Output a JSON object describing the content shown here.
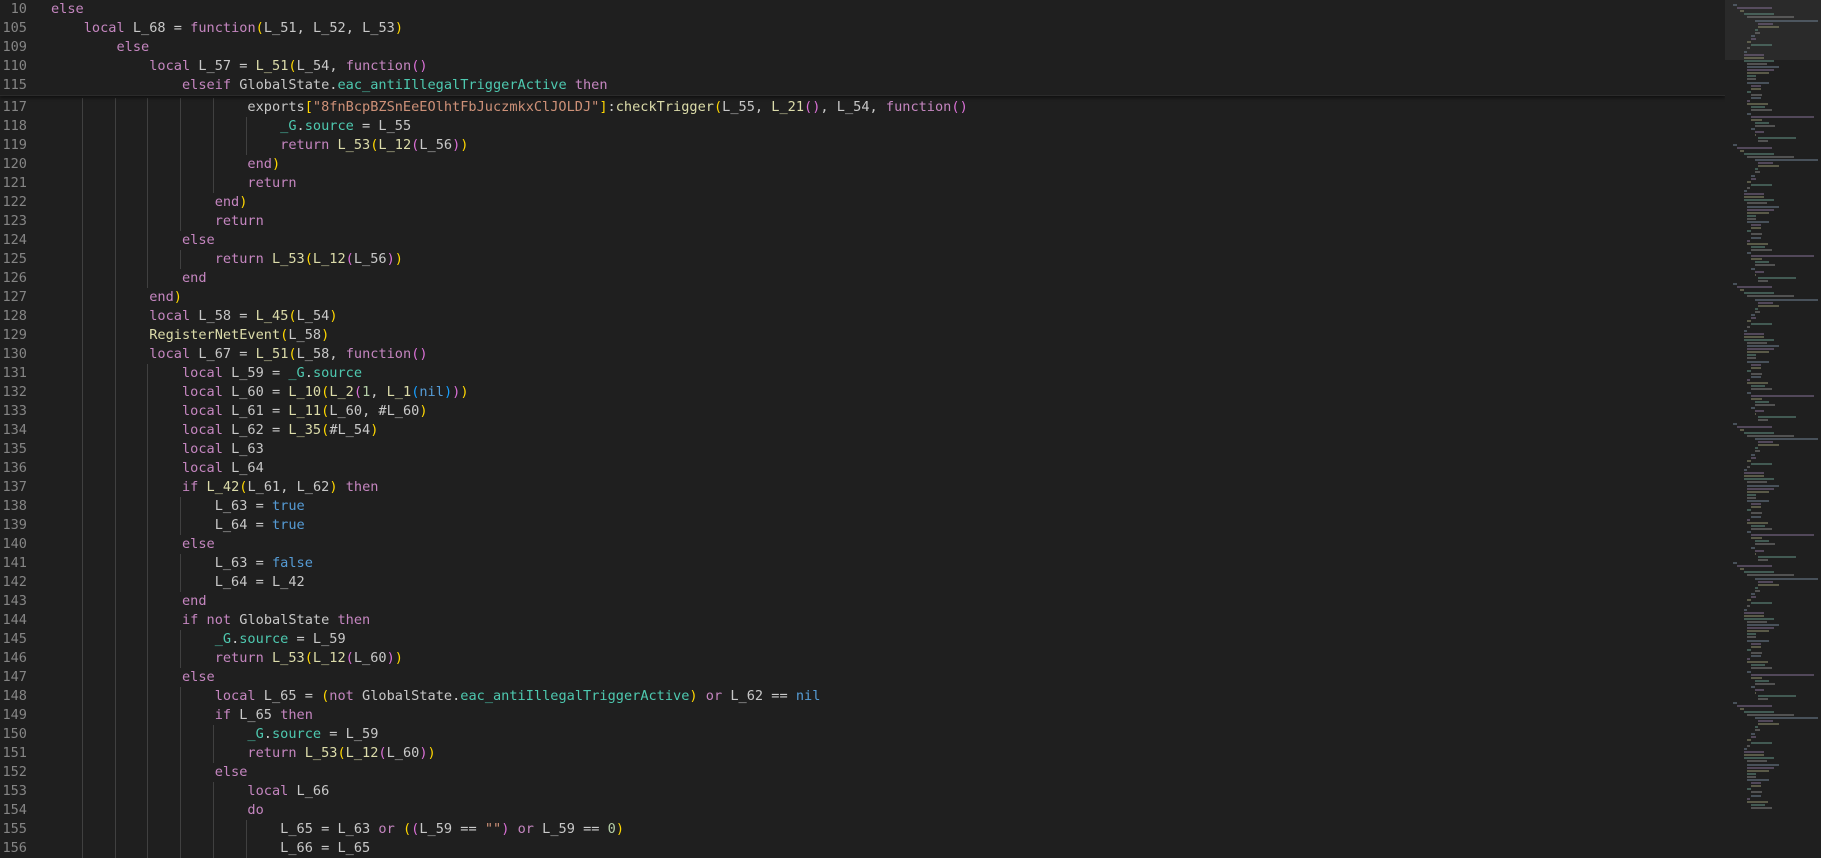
{
  "editor": {
    "sticky_lines": [
      {
        "num": "10",
        "text": "else"
      },
      {
        "num": "105",
        "text": "    local L_68 = function(L_51, L_52, L_53)"
      },
      {
        "num": "109",
        "text": "        else"
      },
      {
        "num": "110",
        "text": "            local L_57 = L_51(L_54, function()"
      },
      {
        "num": "115",
        "text": "                elseif GlobalState.eac_antiIllegalTriggerActive then"
      }
    ],
    "lines": [
      {
        "num": "117",
        "text": "                        exports[\"8fnBcpBZSnEeEOlhtFbJuczmkxClJOLDJ\"]:checkTrigger(L_55, L_21(), L_54, function()"
      },
      {
        "num": "118",
        "text": "                            _G.source = L_55"
      },
      {
        "num": "119",
        "text": "                            return L_53(L_12(L_56))"
      },
      {
        "num": "120",
        "text": "                        end)"
      },
      {
        "num": "121",
        "text": "                        return"
      },
      {
        "num": "122",
        "text": "                    end)"
      },
      {
        "num": "123",
        "text": "                    return"
      },
      {
        "num": "124",
        "text": "                else"
      },
      {
        "num": "125",
        "text": "                    return L_53(L_12(L_56))"
      },
      {
        "num": "126",
        "text": "                end"
      },
      {
        "num": "127",
        "text": "            end)"
      },
      {
        "num": "128",
        "text": "            local L_58 = L_45(L_54)"
      },
      {
        "num": "129",
        "text": "            RegisterNetEvent(L_58)"
      },
      {
        "num": "130",
        "text": "            local L_67 = L_51(L_58, function()"
      },
      {
        "num": "131",
        "text": "                local L_59 = _G.source"
      },
      {
        "num": "132",
        "text": "                local L_60 = L_10(L_2(1, L_1(nil)))"
      },
      {
        "num": "133",
        "text": "                local L_61 = L_11(L_60, #L_60)"
      },
      {
        "num": "134",
        "text": "                local L_62 = L_35(#L_54)"
      },
      {
        "num": "135",
        "text": "                local L_63"
      },
      {
        "num": "136",
        "text": "                local L_64"
      },
      {
        "num": "137",
        "text": "                if L_42(L_61, L_62) then"
      },
      {
        "num": "138",
        "text": "                    L_63 = true"
      },
      {
        "num": "139",
        "text": "                    L_64 = true"
      },
      {
        "num": "140",
        "text": "                else"
      },
      {
        "num": "141",
        "text": "                    L_63 = false"
      },
      {
        "num": "142",
        "text": "                    L_64 = L_42"
      },
      {
        "num": "143",
        "text": "                end"
      },
      {
        "num": "144",
        "text": "                if not GlobalState then"
      },
      {
        "num": "145",
        "text": "                    _G.source = L_59"
      },
      {
        "num": "146",
        "text": "                    return L_53(L_12(L_60))"
      },
      {
        "num": "147",
        "text": "                else"
      },
      {
        "num": "148",
        "text": "                    local L_65 = (not GlobalState.eac_antiIllegalTriggerActive) or L_62 == nil"
      },
      {
        "num": "149",
        "text": "                    if L_65 then"
      },
      {
        "num": "150",
        "text": "                        _G.source = L_59"
      },
      {
        "num": "151",
        "text": "                        return L_53(L_12(L_60))"
      },
      {
        "num": "152",
        "text": "                    else"
      },
      {
        "num": "153",
        "text": "                        local L_66"
      },
      {
        "num": "154",
        "text": "                        do"
      },
      {
        "num": "155",
        "text": "                            L_65 = L_63 or ((L_59 == \"\") or L_59 == 0)"
      },
      {
        "num": "156",
        "text": "                            L_66 = L_65"
      }
    ]
  },
  "colors": {
    "background": "#1f1f1f",
    "keyword": "#c586c0",
    "literal": "#569cd6",
    "function": "#dcdcaa",
    "property": "#4ec9b0",
    "string": "#ce9178"
  }
}
